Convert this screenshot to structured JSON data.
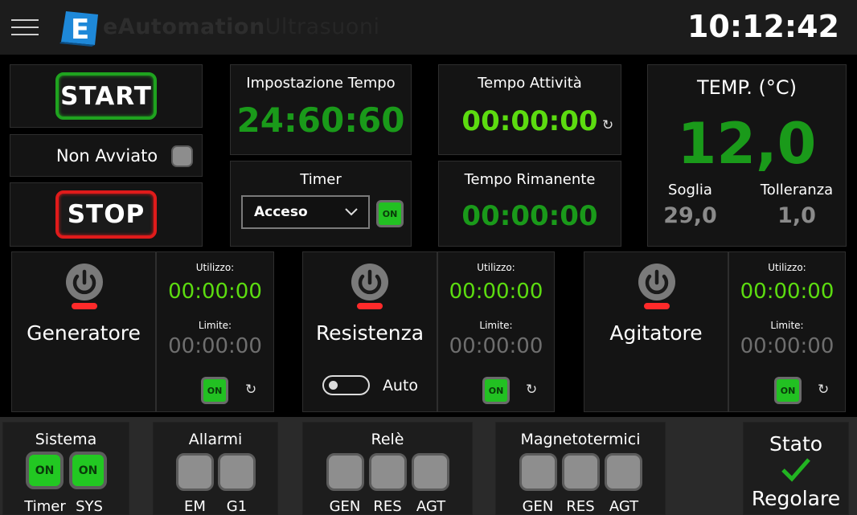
{
  "header": {
    "logo_letter": "E",
    "brand_main": "eAutomation",
    "brand_sub": "Ultrasuoni",
    "clock": "10:12:42"
  },
  "controls": {
    "start_label": "START",
    "stop_label": "STOP",
    "status_label": "Non Avviato"
  },
  "impostazione": {
    "title": "Impostazione Tempo",
    "value": "24:60:60"
  },
  "timer": {
    "title": "Timer",
    "selected": "Acceso",
    "on_label": "ON"
  },
  "attivita": {
    "title": "Tempo Attività",
    "value": "00:00:00"
  },
  "rimanente": {
    "title": "Tempo Rimanente",
    "value": "00:00:00"
  },
  "temperature": {
    "title": "TEMP. (°C)",
    "value": "12,0",
    "soglia_label": "Soglia",
    "soglia_value": "29,0",
    "tolleranza_label": "Tolleranza",
    "tolleranza_value": "1,0"
  },
  "devices": [
    {
      "name": "Generatore",
      "utilizzo_label": "Utilizzo:",
      "utilizzo": "00:00:00",
      "limite_label": "Limite:",
      "limite": "00:00:00",
      "on_label": "ON"
    },
    {
      "name": "Resistenza",
      "utilizzo_label": "Utilizzo:",
      "utilizzo": "00:00:00",
      "limite_label": "Limite:",
      "limite": "00:00:00",
      "on_label": "ON",
      "toggle_label": "Auto"
    },
    {
      "name": "Agitatore",
      "utilizzo_label": "Utilizzo:",
      "utilizzo": "00:00:00",
      "limite_label": "Limite:",
      "limite": "00:00:00",
      "on_label": "ON"
    }
  ],
  "footer": {
    "sistema": {
      "title": "Sistema",
      "timer_label": "Timer",
      "sys_label": "SYS",
      "on1": "ON",
      "on2": "ON"
    },
    "allarmi": {
      "title": "Allarmi",
      "labels": [
        "EM",
        "G1"
      ]
    },
    "rele": {
      "title": "Relè",
      "labels": [
        "GEN",
        "RES",
        "AGT"
      ]
    },
    "magnetotermici": {
      "title": "Magnetotermici",
      "labels": [
        "GEN",
        "RES",
        "AGT"
      ]
    },
    "stato": {
      "title": "Stato",
      "value": "Regolare"
    }
  },
  "colors": {
    "accent_green": "#1a9a1a",
    "lime": "#5cdc10",
    "alert_red": "#e01b1b",
    "on_green": "#22c122"
  }
}
